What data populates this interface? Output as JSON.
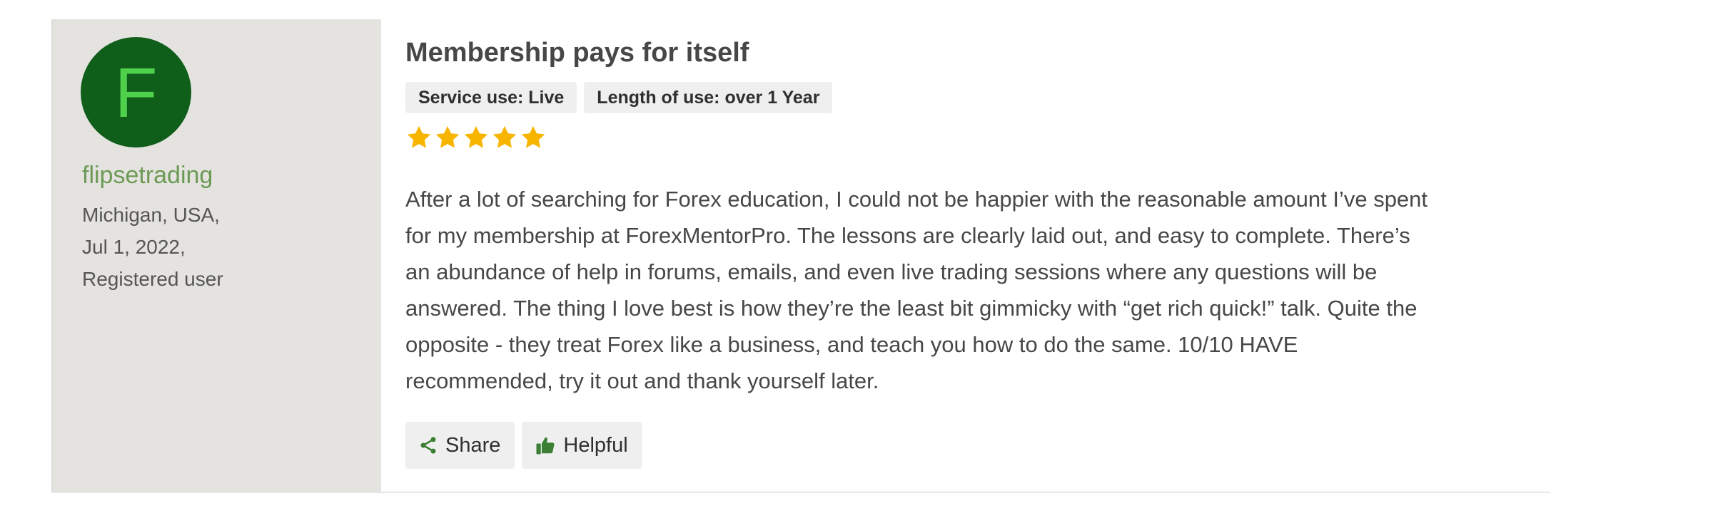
{
  "colors": {
    "avatar_bg": "#0f5f1b",
    "avatar_letter": "#4fd14b",
    "author_name": "#6c9a56",
    "star": "#f7b500",
    "panel_bg": "#e5e3df",
    "action_icon": "#3a7f34"
  },
  "author": {
    "initial": "F",
    "name": "flipsetrading",
    "location": "Michigan, USA,",
    "date": "Jul 1, 2022,",
    "status": "Registered user"
  },
  "review": {
    "title": "Membership pays for itself",
    "tags": [
      {
        "label": "Service use: Live"
      },
      {
        "label": "Length of use: over 1 Year"
      }
    ],
    "rating": 5,
    "rating_max": 5,
    "body_lines": [
      "After a lot of searching for Forex education, I could not be happier with the reasonable amount I’ve spent",
      "for my membership at ForexMentorPro. The lessons are clearly laid out, and easy to complete. There’s",
      "an abundance of help in forums, emails, and even live trading sessions where any questions will be",
      "answered. The thing I love best is how they’re the least bit gimmicky with “get rich quick!” talk. Quite the",
      "opposite - they treat Forex like a business, and teach you how to do the same. 10/10 HAVE",
      "recommended, try it out and thank yourself later."
    ]
  },
  "actions": {
    "share_label": "Share",
    "share_icon": "share-icon",
    "helpful_label": "Helpful",
    "helpful_icon": "thumbs-up-icon"
  }
}
